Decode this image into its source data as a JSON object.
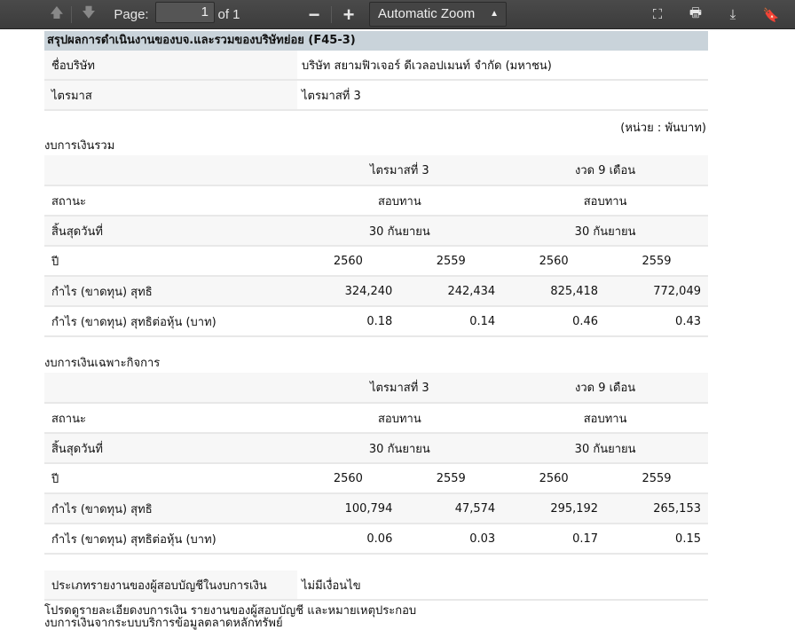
{
  "toolbar": {
    "page_label": "Page:",
    "page_value": "1",
    "page_of": "of 1",
    "zoom_out": "−",
    "zoom_in": "+",
    "zoom_select": "Automatic Zoom"
  },
  "title": "สรุปผลการดำเนินงานของบจ.และรวมของบริษัทย่อย (F45-3)",
  "info": [
    {
      "label": "ชื่อบริษัท",
      "value": "บริษัท สยามฟิวเจอร์ ดีเวลอปเมนท์ จำกัด (มหาชน)"
    },
    {
      "label": "ไตรมาส",
      "value": "ไตรมาสที่ 3"
    }
  ],
  "unit": "(หน่วย : พันบาท)",
  "tables": [
    {
      "caption": "งบการเงินรวม",
      "period_headers": [
        "ไตรมาสที่ 3",
        "งวด 9 เดือน"
      ],
      "status_label": "สถานะ",
      "status": [
        "สอบทาน",
        "สอบทาน"
      ],
      "end_label": "สิ้นสุดวันที่",
      "end": [
        "30 กันยายน",
        "30 กันยายน"
      ],
      "year_label": "ปี",
      "years": [
        "2560",
        "2559",
        "2560",
        "2559"
      ],
      "rows": [
        {
          "label": "กำไร (ขาดทุน) สุทธิ",
          "values": [
            "324,240",
            "242,434",
            "825,418",
            "772,049"
          ]
        },
        {
          "label": "กำไร (ขาดทุน) สุทธิต่อหุ้น (บาท)",
          "values": [
            "0.18",
            "0.14",
            "0.46",
            "0.43"
          ]
        }
      ]
    },
    {
      "caption": "งบการเงินเฉพาะกิจการ",
      "period_headers": [
        "ไตรมาสที่ 3",
        "งวด 9 เดือน"
      ],
      "status_label": "สถานะ",
      "status": [
        "สอบทาน",
        "สอบทาน"
      ],
      "end_label": "สิ้นสุดวันที่",
      "end": [
        "30 กันยายน",
        "30 กันยายน"
      ],
      "year_label": "ปี",
      "years": [
        "2560",
        "2559",
        "2560",
        "2559"
      ],
      "rows": [
        {
          "label": "กำไร (ขาดทุน) สุทธิ",
          "values": [
            "100,794",
            "47,574",
            "295,192",
            "265,153"
          ]
        },
        {
          "label": "กำไร (ขาดทุน) สุทธิต่อหุ้น (บาท)",
          "values": [
            "0.06",
            "0.03",
            "0.17",
            "0.15"
          ]
        }
      ]
    }
  ],
  "report": {
    "label": "ประเภทรายงานของผู้สอบบัญชีในงบการเงิน",
    "value": "ไม่มีเงื่อนไข"
  },
  "note": [
    "โปรดดูรายละเอียดงบการเงิน รายงานของผู้สอบบัญชี และหมายเหตุประกอบ",
    "งบการเงินจากระบบบริการข้อมูลตลาดหลักทรัพย์"
  ]
}
